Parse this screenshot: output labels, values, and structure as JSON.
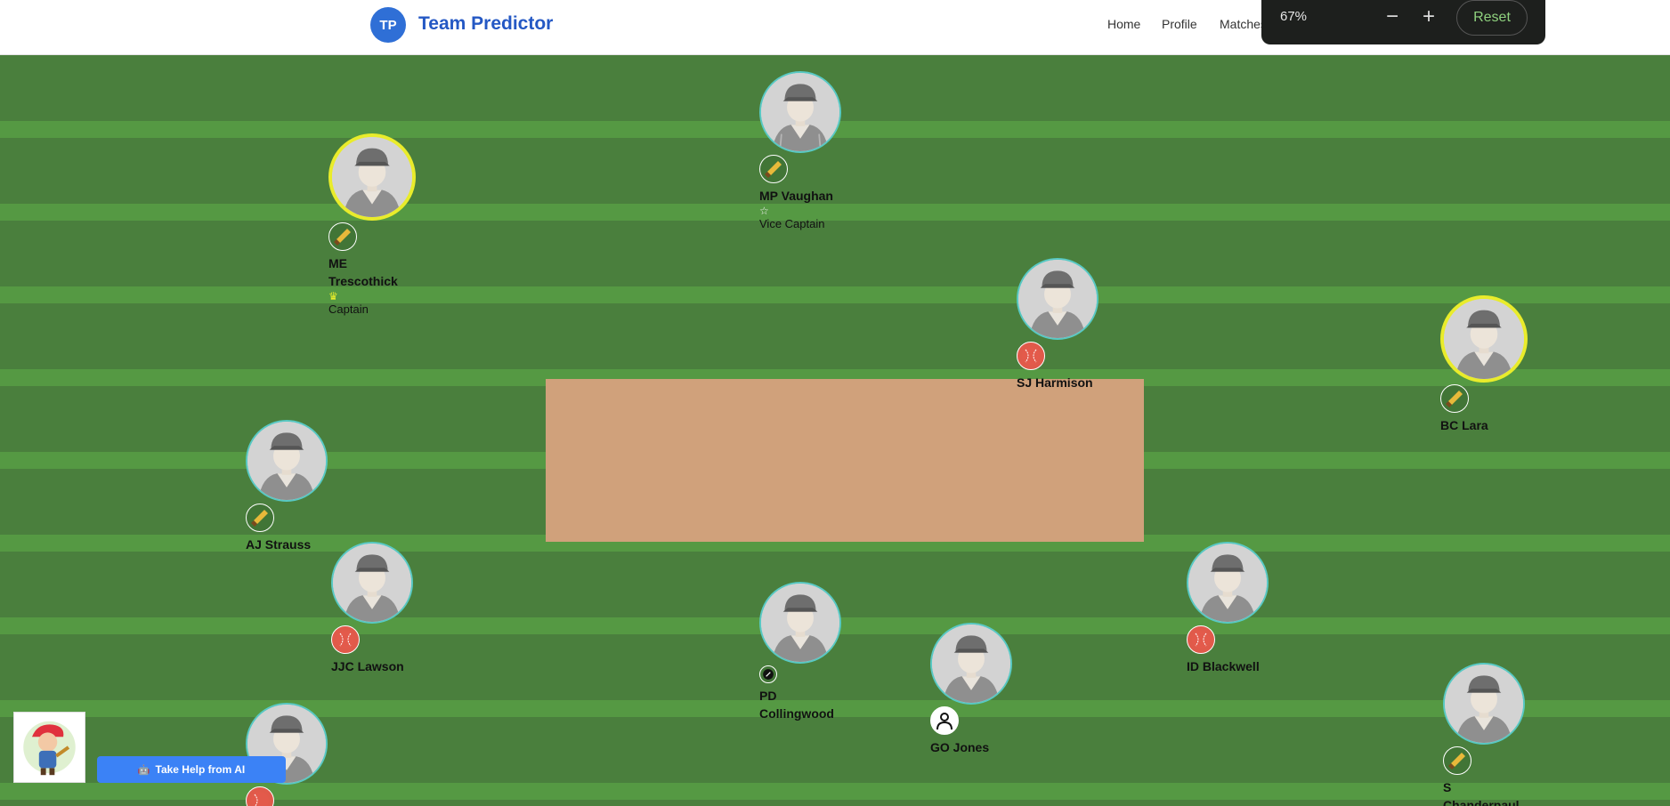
{
  "header": {
    "logo_initials": "TP",
    "brand": "Team Predictor",
    "nav": [
      "Home",
      "Profile",
      "Matches"
    ]
  },
  "zoom": {
    "level": "67%",
    "minus": "−",
    "plus": "+",
    "reset": "Reset"
  },
  "players": [
    {
      "name": "MP Vaughan",
      "role": "bat",
      "badge": "Vice Captain"
    },
    {
      "name": "ME Trescothick",
      "role": "bat",
      "badge": "Captain"
    },
    {
      "name": "SJ Harmison",
      "role": "bowl"
    },
    {
      "name": "BC Lara",
      "role": "bat"
    },
    {
      "name": "AJ Strauss",
      "role": "bat"
    },
    {
      "name": "JJC Lawson",
      "role": "bowl"
    },
    {
      "name": "PD Collingwood",
      "role": "allround"
    },
    {
      "name": "GO Jones",
      "role": "keeper"
    },
    {
      "name": "ID Blackwell",
      "role": "bowl"
    },
    {
      "name": "S Chanderpaul",
      "role": "bat"
    },
    {
      "name": "",
      "role": "bowl"
    }
  ],
  "help": {
    "button": "Take Help from AI"
  },
  "colors": {
    "field_dark": "#4a7f3d",
    "field_light": "#559943",
    "pitch": "#d0a17b",
    "captain_ring": "#e9ec2b",
    "avatar_ring": "#58c9c4",
    "brand": "#2458c4"
  }
}
